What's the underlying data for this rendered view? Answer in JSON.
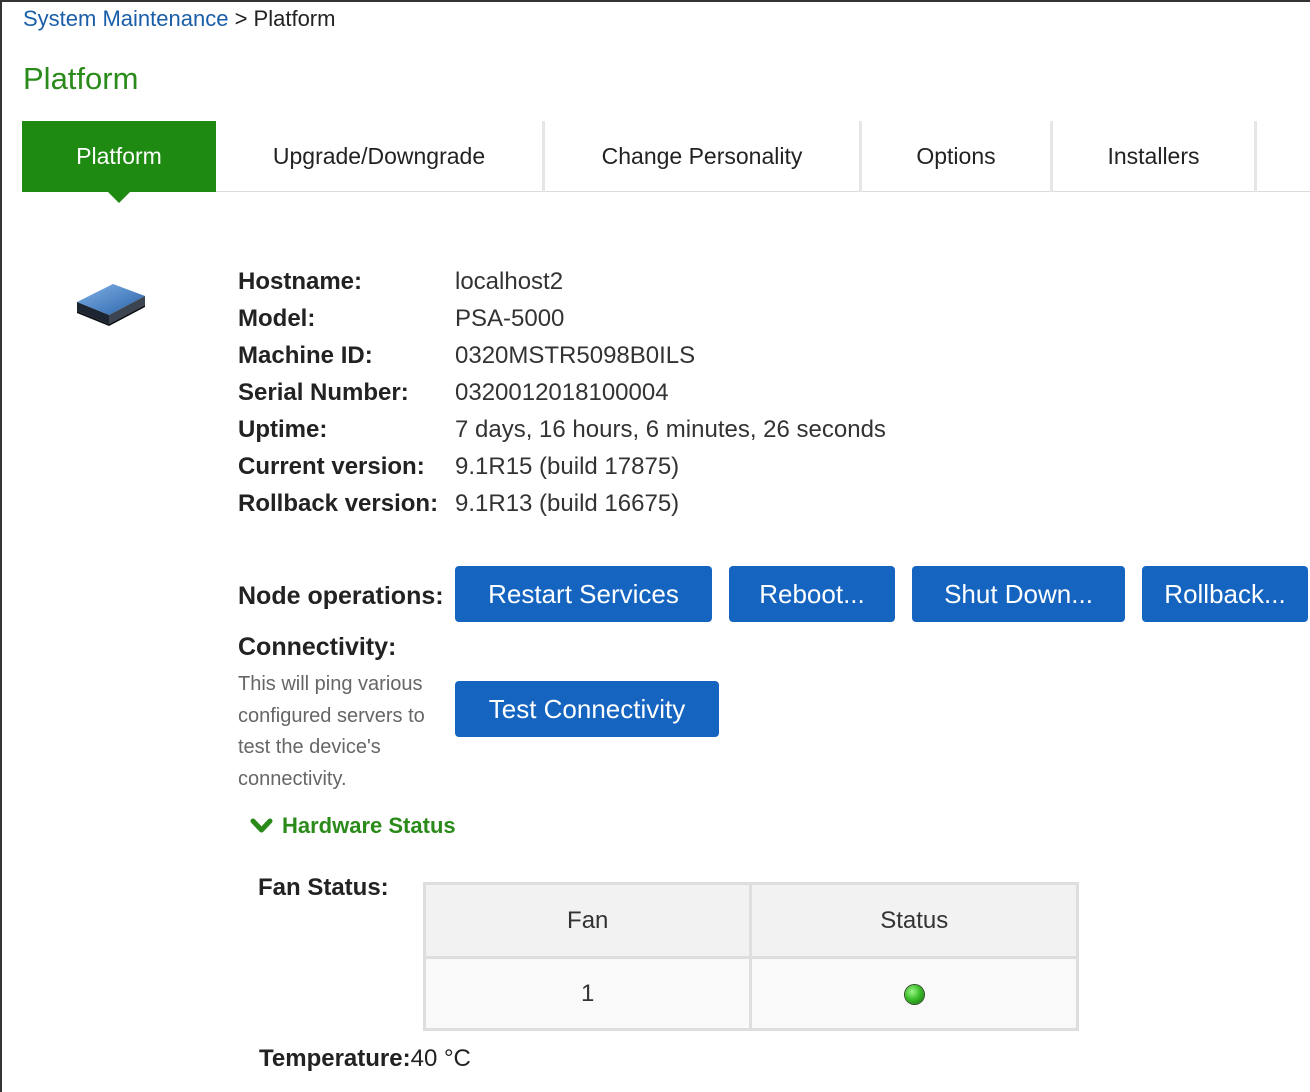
{
  "breadcrumb": {
    "parent": "System Maintenance",
    "separator": ">",
    "current": "Platform"
  },
  "page_title": "Platform",
  "tabs": [
    {
      "label": "Platform",
      "active": true
    },
    {
      "label": "Upgrade/Downgrade",
      "active": false
    },
    {
      "label": "Change Personality",
      "active": false
    },
    {
      "label": "Options",
      "active": false
    },
    {
      "label": "Installers",
      "active": false
    }
  ],
  "device_icon": "server-appliance-icon",
  "info": [
    {
      "label": "Hostname:",
      "value": "localhost2"
    },
    {
      "label": "Model:",
      "value": "PSA-5000"
    },
    {
      "label": "Machine ID:",
      "value": "0320MSTR5098B0ILS"
    },
    {
      "label": "Serial Number:",
      "value": "0320012018100004"
    },
    {
      "label": "Uptime:",
      "value": "7 days, 16 hours, 6 minutes, 26 seconds"
    },
    {
      "label": "Current version:",
      "value": "9.1R15 (build 17875)"
    },
    {
      "label": "Rollback version:",
      "value": "9.1R13 (build 16675)"
    }
  ],
  "node_operations": {
    "label": "Node operations:",
    "buttons": [
      "Restart Services",
      "Reboot...",
      "Shut Down...",
      "Rollback..."
    ]
  },
  "connectivity": {
    "label": "Connectivity:",
    "description": "This will ping various configured servers to test the device's connectivity.",
    "button": "Test Connectivity"
  },
  "hardware_status": {
    "toggle_label": "Hardware Status",
    "fan_label": "Fan Status:",
    "fan_table": {
      "headers": [
        "Fan",
        "Status"
      ],
      "rows": [
        {
          "fan": "1",
          "status": "ok",
          "status_color": "#3cbf2a"
        }
      ]
    },
    "temperature_label": "Temperature:",
    "temperature_value": "40 °C"
  },
  "colors": {
    "accent_green": "#1e8a12",
    "button_blue": "#1565c0",
    "link_blue": "#1a5ea8"
  }
}
